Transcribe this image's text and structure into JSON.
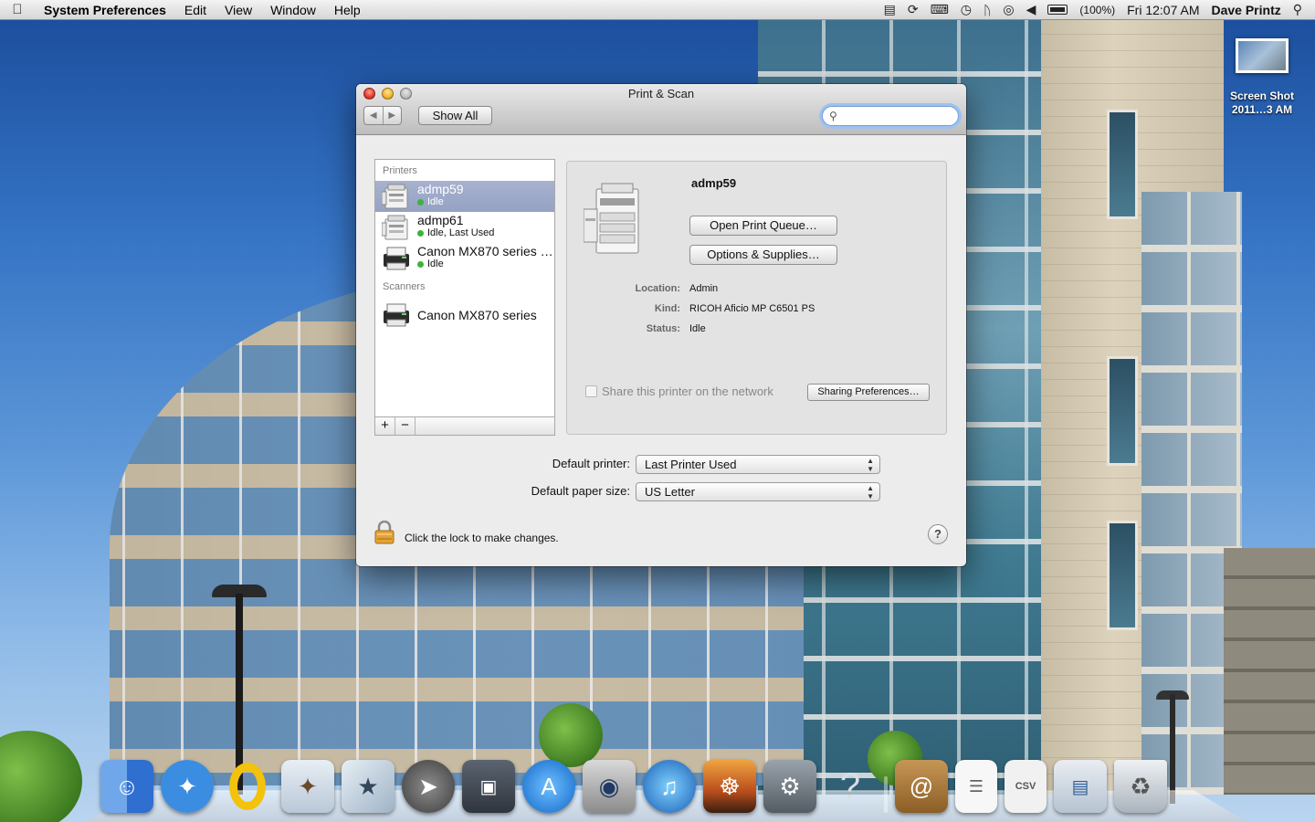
{
  "menubar": {
    "app_name": "System Preferences",
    "menus": [
      "Edit",
      "View",
      "Window",
      "Help"
    ],
    "battery": "(100%)",
    "clock": "Fri 12:07 AM",
    "user": "Dave Printz"
  },
  "desktop": {
    "icon_label_line1": "Screen Shot",
    "icon_label_line2": "2011…3 AM"
  },
  "window": {
    "title": "Print & Scan",
    "show_all": "Show All",
    "search_placeholder": "",
    "list": {
      "printers_header": "Printers",
      "printers": [
        {
          "name": "admp59",
          "status": "Idle",
          "selected": true
        },
        {
          "name": "admp61",
          "status": "Idle, Last Used"
        },
        {
          "name": "Canon MX870 series (…",
          "status": "Idle"
        }
      ],
      "scanners_header": "Scanners",
      "scanners": [
        {
          "name": "Canon MX870 series"
        }
      ],
      "add_label": "+",
      "remove_label": "−"
    },
    "detail": {
      "name": "admp59",
      "open_queue": "Open Print Queue…",
      "options_supplies": "Options & Supplies…",
      "location_label": "Location:",
      "location": "Admin",
      "kind_label": "Kind:",
      "kind": "RICOH Aficio MP C6501 PS",
      "status_label": "Status:",
      "status": "Idle",
      "share_label": "Share this printer on the network",
      "sharing_prefs": "Sharing Preferences…"
    },
    "defaults": {
      "printer_label": "Default printer:",
      "printer_value": "Last Printer Used",
      "paper_label": "Default paper size:",
      "paper_value": "US Letter"
    },
    "lock_text": "Click the lock to make changes.",
    "help": "?"
  },
  "dock": {
    "items": [
      "Finder",
      "Safari",
      "Opera",
      "Mail",
      "iPhoto",
      "Launchpad",
      "Preview",
      "App Store",
      "FaceTime",
      "iTunes",
      "iPhoto Library",
      "System Preferences",
      "Help",
      "Address Book",
      "Document",
      "CSV",
      "Screen",
      "Trash"
    ]
  },
  "colors": {
    "selection": "#95a2c3",
    "status_dot": "#3bb43b",
    "search_focus": "#9cc2f2"
  }
}
